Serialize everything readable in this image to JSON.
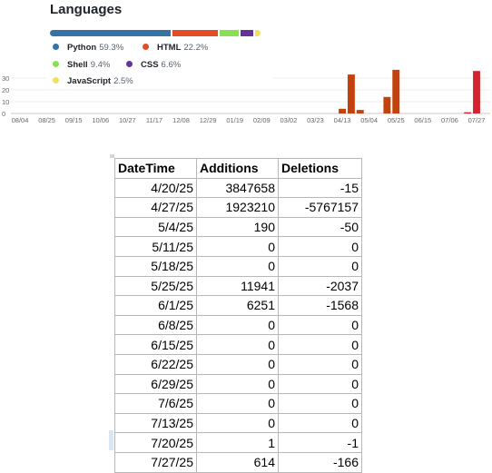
{
  "languages": {
    "title": "Languages",
    "items": [
      {
        "name": "Python",
        "percent": "59.3%",
        "color": "#3572A5",
        "share": 59.3
      },
      {
        "name": "HTML",
        "percent": "22.2%",
        "color": "#e34c26",
        "share": 22.2
      },
      {
        "name": "Shell",
        "percent": "9.4%",
        "color": "#89e051",
        "share": 9.4
      },
      {
        "name": "CSS",
        "percent": "6.6%",
        "color": "#663399",
        "share": 6.6
      },
      {
        "name": "JavaScript",
        "percent": "2.5%",
        "color": "#f1e05a",
        "share": 2.5
      }
    ]
  },
  "chart_data": {
    "type": "bar",
    "y_ticks": [
      "0",
      "10",
      "20",
      "30"
    ],
    "ylim": [
      0,
      40
    ],
    "x_tick_labels": [
      "08/04",
      "08/25",
      "09/15",
      "10/06",
      "10/27",
      "11/17",
      "12/08",
      "12/29",
      "01/19",
      "02/09",
      "03/02",
      "03/23",
      "04/13",
      "05/04",
      "05/25",
      "06/15",
      "07/06",
      "07/27"
    ],
    "bar_colors": {
      "commits": "#c2410c",
      "recent": "#d1242f"
    },
    "bars": [
      {
        "week": "04/13",
        "value": 4
      },
      {
        "week": "04/20",
        "value": 33
      },
      {
        "week": "04/27",
        "value": 3
      },
      {
        "week": "05/18",
        "value": 14
      },
      {
        "week": "05/25",
        "value": 37
      },
      {
        "week": "07/20",
        "value": 1
      },
      {
        "week": "07/27",
        "value": 36
      }
    ]
  },
  "sheet": {
    "headers": [
      "DateTime",
      "Additions",
      "Deletions"
    ],
    "rows": [
      [
        "4/20/25",
        "3847658",
        "-15"
      ],
      [
        "4/27/25",
        "1923210",
        "-5767157"
      ],
      [
        "5/4/25",
        "190",
        "-50"
      ],
      [
        "5/11/25",
        "0",
        "0"
      ],
      [
        "5/18/25",
        "0",
        "0"
      ],
      [
        "5/25/25",
        "11941",
        "-2037"
      ],
      [
        "6/1/25",
        "6251",
        "-1568"
      ],
      [
        "6/8/25",
        "0",
        "0"
      ],
      [
        "6/15/25",
        "0",
        "0"
      ],
      [
        "6/22/25",
        "0",
        "0"
      ],
      [
        "6/29/25",
        "0",
        "0"
      ],
      [
        "7/6/25",
        "0",
        "0"
      ],
      [
        "7/13/25",
        "0",
        "0"
      ],
      [
        "7/20/25",
        "1",
        "-1"
      ],
      [
        "7/27/25",
        "614",
        "-166"
      ]
    ]
  }
}
